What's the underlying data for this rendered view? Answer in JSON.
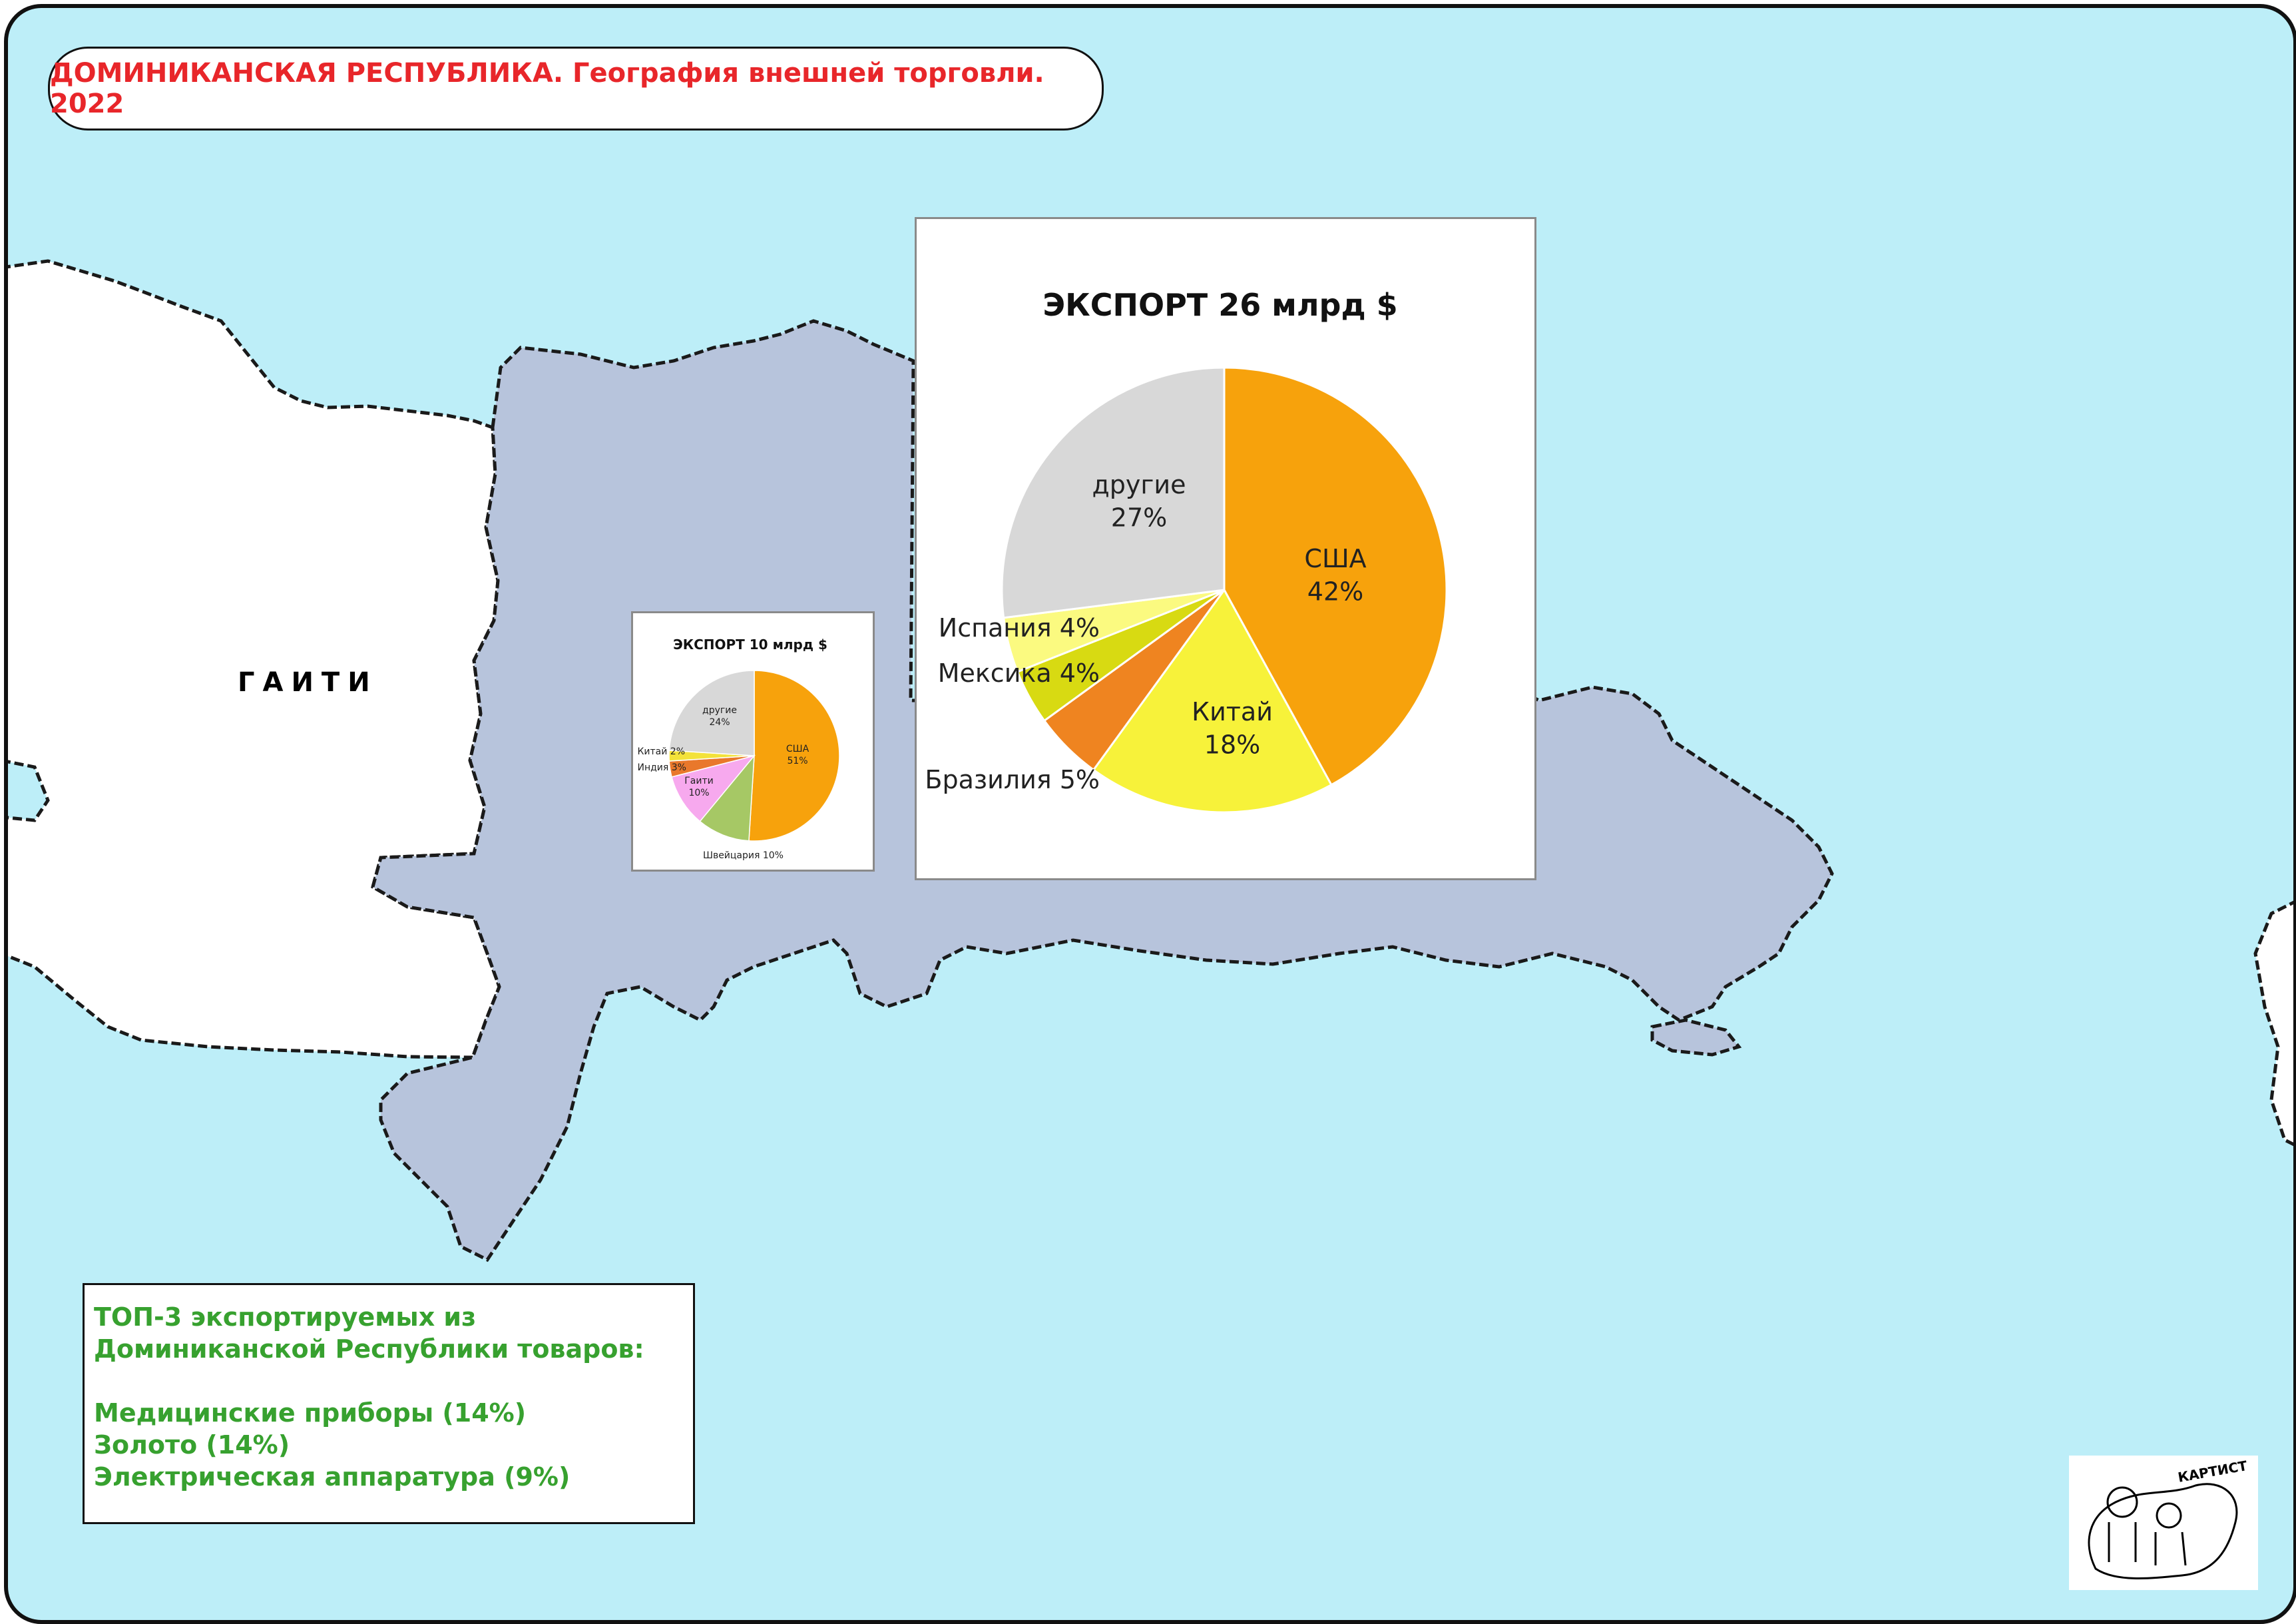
{
  "title": "ДОМИНИКАНСКАЯ РЕСПУБЛИКА. География внешней торговли. 2022",
  "map": {
    "haiti_label": "ГАИТИ",
    "colors": {
      "sea": "#bdeef8",
      "dominican_republic": "#b7c4dc",
      "other_land": "#ffffff",
      "border": "#1a1a1a"
    }
  },
  "chart_data": [
    {
      "type": "pie",
      "title": "ЭКСПОРТ 10 млрд $",
      "slices": [
        {
          "label": "США",
          "value": 51,
          "text": "51%",
          "color": "#f7a20c"
        },
        {
          "label": "Швейцария",
          "value": 10,
          "text": "Швейцария 10%",
          "color": "#a6c865"
        },
        {
          "label": "Гаити",
          "value": 10,
          "text": "10%",
          "color": "#f7a9ee"
        },
        {
          "label": "Индия",
          "value": 3,
          "text": "Индия 3%",
          "color": "#e9782b"
        },
        {
          "label": "Китай",
          "value": 2,
          "text": "Китай 2%",
          "color": "#f3e23a"
        },
        {
          "label": "другие",
          "value": 24,
          "text": "24%",
          "color": "#d8d8d8"
        }
      ]
    },
    {
      "type": "pie",
      "title": "ЭКСПОРТ 26 млрд $",
      "slices": [
        {
          "label": "США",
          "value": 42,
          "text": "42%",
          "color": "#f7a20c"
        },
        {
          "label": "Китай",
          "value": 18,
          "text": "18%",
          "color": "#f7f23a"
        },
        {
          "label": "Бразилия",
          "value": 5,
          "text": "Бразилия 5%",
          "color": "#ef8420"
        },
        {
          "label": "Мексика",
          "value": 4,
          "text": "Мексика 4%",
          "color": "#d8da12"
        },
        {
          "label": "Испания",
          "value": 4,
          "text": "Испания 4%",
          "color": "#fbfa80"
        },
        {
          "label": "другие",
          "value": 27,
          "text": "27%",
          "color": "#d8d8d8"
        }
      ]
    }
  ],
  "top_exports": {
    "heading_line1": "ТОП-3 экспортируемых из",
    "heading_line2": "Доминиканской Республики товаров:",
    "items": [
      "Медицинские приборы (14%)",
      "Золото (14%)",
      "Электрическая аппаратура (9%)"
    ]
  },
  "logo": {
    "text": "КАРТИСТ"
  }
}
